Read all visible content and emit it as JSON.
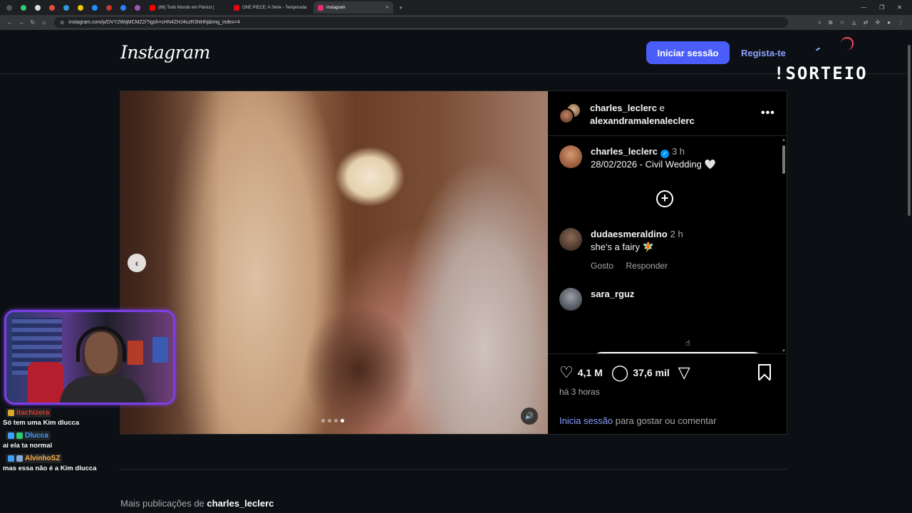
{
  "browser": {
    "tabs": [
      {
        "title": "(86) Todo Mundo em Pânico | ",
        "color": "#ff0000",
        "active": false
      },
      {
        "title": "ONE PIECE: A Série - Temporada",
        "color": "#e50914",
        "active": false
      },
      {
        "title": "Instagram",
        "color": "#e1306c",
        "active": true
      }
    ],
    "url": "instagram.com/p/DVY2WqMCMZ2/?igsh=cHN4ZHJ4czR3NHhj&img_index=4"
  },
  "header": {
    "logo": "Instagram",
    "login_button": "Iniciar sessão",
    "register_link": "Regista-te"
  },
  "overlay": {
    "title": "!SORTEIO"
  },
  "post": {
    "carousel": {
      "count": 4,
      "active_index": 4
    },
    "authors": {
      "first": "charles_leclerc",
      "joiner": "e",
      "second": "alexandramalenaleclerc"
    },
    "caption": {
      "user": "charles_leclerc",
      "time": "3 h",
      "text": "28/02/2026 - Civil Wedding 🤍"
    },
    "comments": [
      {
        "user": "dudaesmeraldino",
        "time": "2 h",
        "text": "she's a fairy 🧚",
        "like_label": "Gosto",
        "reply_label": "Responder"
      },
      {
        "user": "sara_rguz"
      }
    ],
    "likes": "4,1 M",
    "comments_count": "37,6 mil",
    "time_ago": "há 3 horas",
    "login_prompt_link": "Inicia sessão",
    "login_prompt_rest": " para gostar ou comentar"
  },
  "more_posts": {
    "prefix": "Mais publicações de ",
    "user": "charles_leclerc"
  },
  "chat": [
    {
      "nick": "itachizera",
      "nick_color": "#e0392b",
      "text": "Só tem uma Kim dlucca"
    },
    {
      "nick": "Dlucca",
      "nick_color": "#3aa0ff",
      "text": "ai ela ta normal"
    },
    {
      "nick": "AlvinhoSZ",
      "nick_color": "#ffb347",
      "text": "mas essa não é a Kim dlucca"
    }
  ],
  "colors": {
    "accent": "#4a5df9",
    "link": "#8ea0ff",
    "verified": "#0095f6",
    "webcam_border": "#7b3fe4"
  }
}
